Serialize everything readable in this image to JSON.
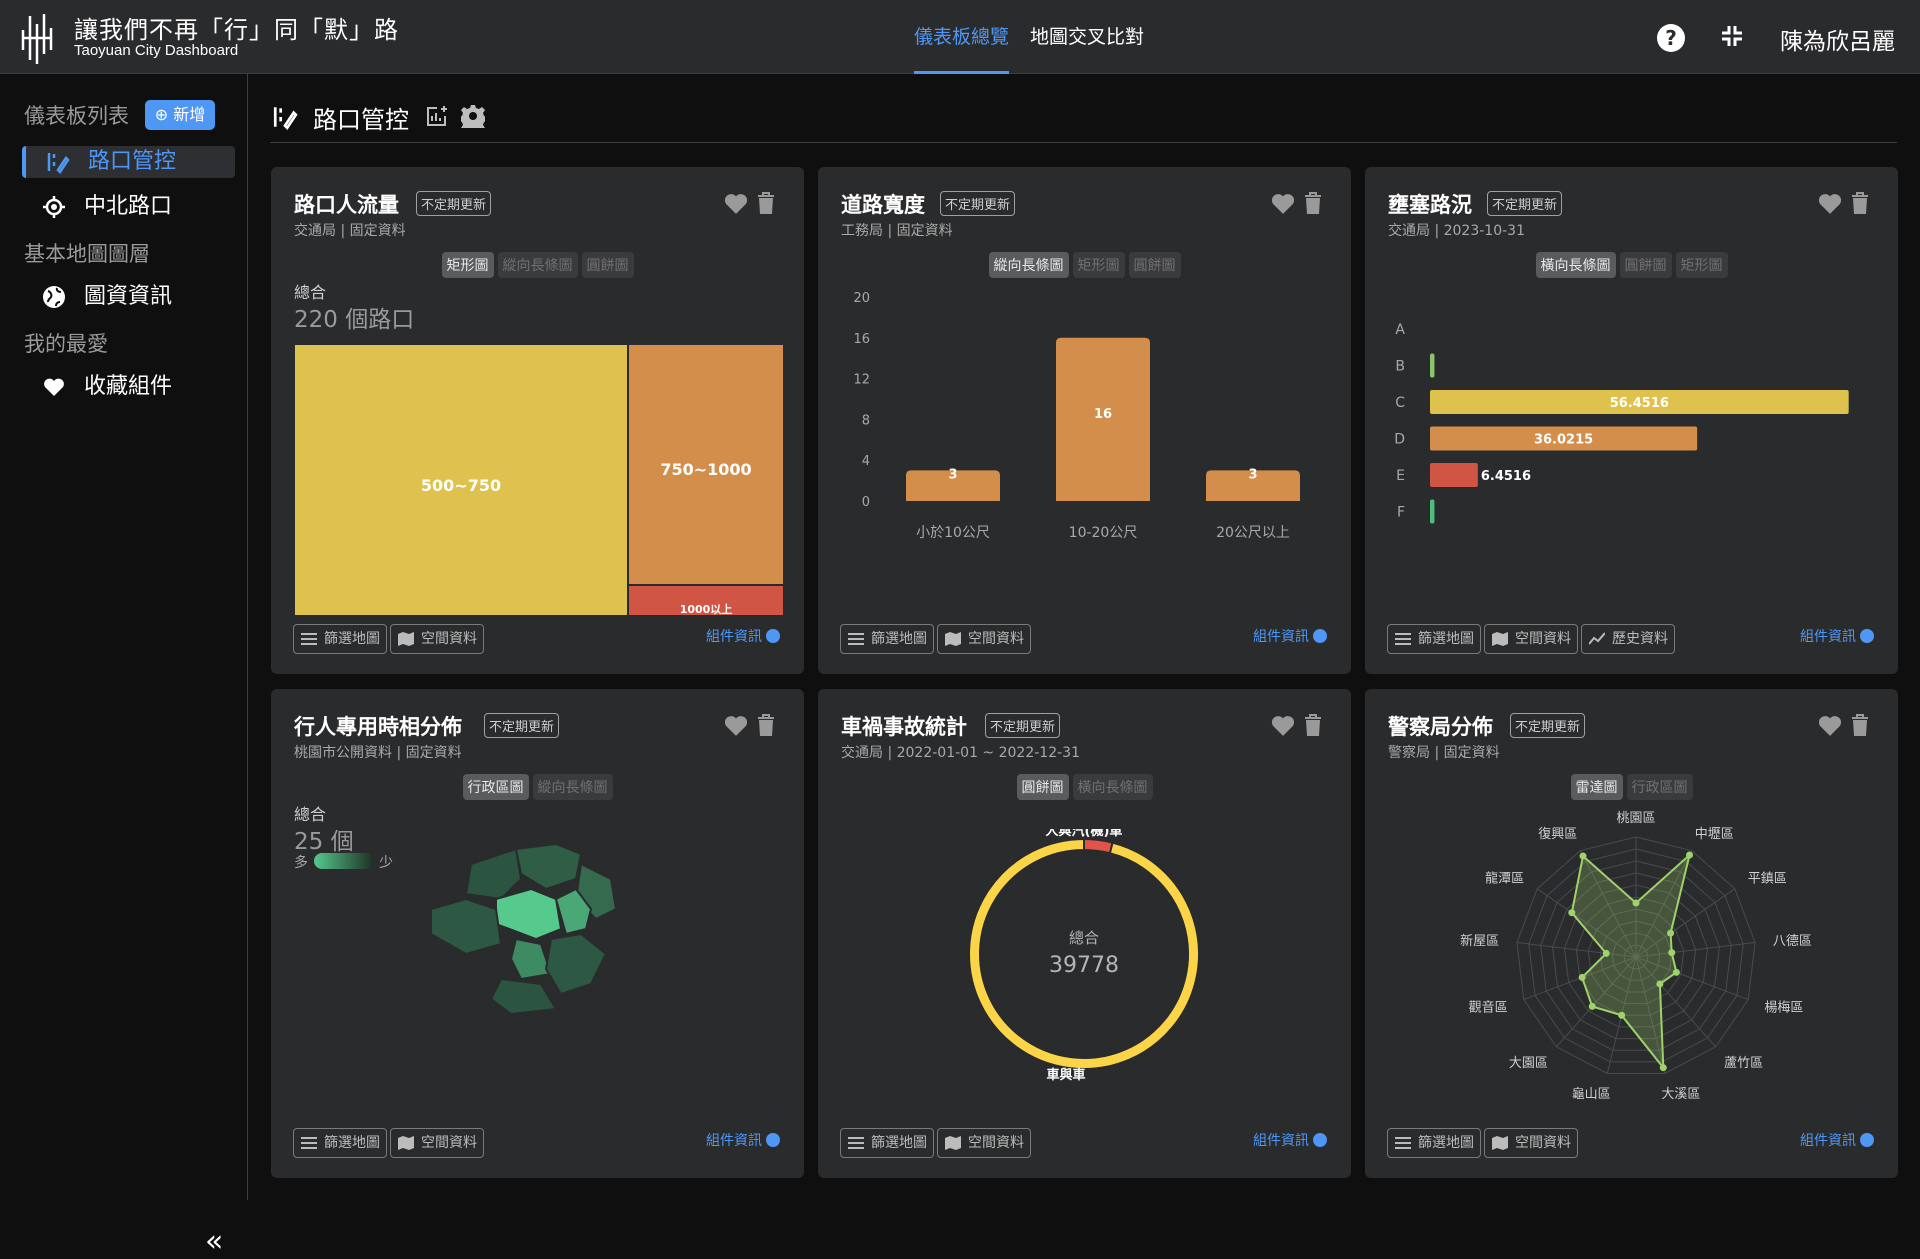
{
  "header": {
    "title": "讓我們不再「行」同「默」路",
    "subtitle": "Taoyuan City Dashboard",
    "tabs": [
      {
        "label": "儀表板總覽",
        "active": true
      },
      {
        "label": "地圖交叉比對",
        "active": false
      }
    ],
    "user": "陳為欣呂麗",
    "help_label": "?"
  },
  "sidebar": {
    "section1": "儀表板列表",
    "add_label": "⊕ 新增",
    "item1": "路口管控",
    "item2": "中北路口",
    "section2": "基本地圖圖層",
    "item3": "圖資資訊",
    "section3": "我的最愛",
    "item4": "收藏組件",
    "collapse": "«"
  },
  "page": {
    "title": "路口管控"
  },
  "common": {
    "badge": "不定期更新",
    "filter": "篩選地圖",
    "spatial": "空間資料",
    "history": "歷史資料",
    "info": "組件資訊"
  },
  "cards": {
    "c1": {
      "title": "路口人流量",
      "source": "交通局 | 固定資料",
      "tabs": [
        "矩形圖",
        "縱向長條圖",
        "圓餅圖"
      ],
      "total_label": "總合",
      "total_value": "220 個路口",
      "chart_data": {
        "type": "treemap",
        "categories": [
          "500~750",
          "750~1000",
          "1000以上"
        ],
        "colors": [
          "#dfc14d",
          "#d38e4c",
          "#d05545"
        ]
      }
    },
    "c2": {
      "title": "道路寬度",
      "source": "工務局 | 固定資料",
      "tabs": [
        "縱向長條圖",
        "矩形圖",
        "圓餅圖"
      ],
      "chart_data": {
        "type": "bar",
        "categories": [
          "小於10公尺",
          "10-20公尺",
          "20公尺以上"
        ],
        "values": [
          3,
          16,
          3
        ],
        "ylim": [
          0,
          20
        ],
        "yticks": [
          "0",
          "4",
          "8",
          "12",
          "16",
          "20"
        ],
        "color": "#d38e4c"
      }
    },
    "c3": {
      "title": "壅塞路況",
      "source": "交通局 | 2023-10-31",
      "tabs": [
        "橫向長條圖",
        "圓餅圖",
        "矩形圖"
      ],
      "chart_data": {
        "type": "bar",
        "orientation": "horizontal",
        "categories": [
          "A",
          "B",
          "C",
          "D",
          "E",
          "F"
        ],
        "values": [
          0,
          0.6,
          56.4516,
          36.0215,
          6.4516,
          0.6
        ],
        "labels": [
          "",
          "",
          "56.4516",
          "36.0215",
          "6.4516",
          ""
        ],
        "colors": [
          "#8bc46a",
          "#8bc46a",
          "#dfc14d",
          "#d38e4c",
          "#d05545",
          "#4bbf7e"
        ],
        "xlim": [
          0,
          60
        ]
      }
    },
    "c4": {
      "title": "行人專用時相分佈",
      "source": "桃園市公開資料 | 固定資料",
      "tabs": [
        "行政區圖",
        "縱向長條圖"
      ],
      "total_label": "總合",
      "total_value": "25 個",
      "legend_more": "多",
      "legend_less": "少"
    },
    "c5": {
      "title": "車禍事故統計",
      "source": "交通局 | 2022-01-01 ~ 2022-12-31",
      "tabs": [
        "圓餅圖",
        "橫向長條圖"
      ],
      "center_label": "總合",
      "center_value": "39778",
      "chart_data": {
        "type": "pie",
        "categories": [
          "人與汽(機)車",
          "車與車"
        ],
        "fractions": [
          0.04,
          0.96
        ],
        "colors": [
          "#e0544a",
          "#fbd547"
        ]
      }
    },
    "c6": {
      "title": "警察局分佈",
      "source": "警察局 | 固定資料",
      "tabs": [
        "雷達圖",
        "行政區圖"
      ],
      "chart_data": {
        "type": "radar",
        "categories": [
          "桃園區",
          "中壢區",
          "平鎮區",
          "八德區",
          "楊梅區",
          "蘆竹區",
          "大溪區",
          "龜山區",
          "大園區",
          "觀音區",
          "新屋區",
          "龍潭區",
          "復興區"
        ],
        "values": [
          0.45,
          0.96,
          0.35,
          0.3,
          0.36,
          0.3,
          0.95,
          0.5,
          0.55,
          0.48,
          0.25,
          0.65,
          0.95
        ],
        "color": "#9fd26b"
      }
    }
  }
}
